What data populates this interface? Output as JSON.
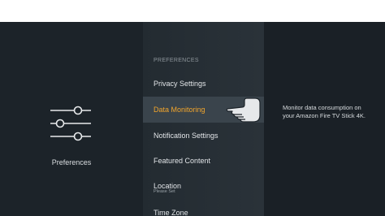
{
  "icons": {
    "preferences": "sliders-icon",
    "pointer": "pointing-hand-icon"
  },
  "colors": {
    "accent": "#f1a52c",
    "background": "#1a2026",
    "highlight": "#3a444c"
  },
  "left_panel": {
    "title": "Preferences"
  },
  "menu": {
    "header": "PREFERENCES",
    "items": [
      {
        "label": "Privacy Settings"
      },
      {
        "label": "Data Monitoring",
        "selected": true
      },
      {
        "label": "Notification Settings"
      },
      {
        "label": "Featured Content"
      },
      {
        "label": "Location",
        "sublabel": "Please Set"
      },
      {
        "label": "Time Zone"
      }
    ]
  },
  "description": {
    "text": "Monitor data consumption on your Amazon Fire TV Stick 4K."
  }
}
